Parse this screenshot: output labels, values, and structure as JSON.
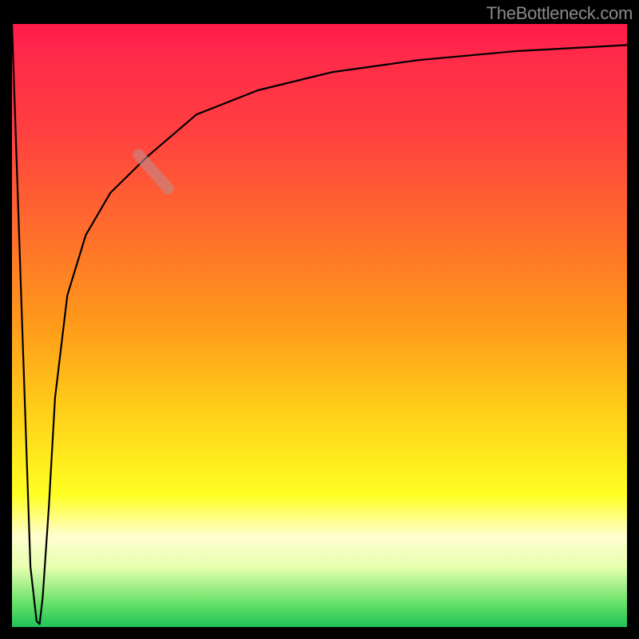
{
  "watermark": "TheBottleneck.com",
  "chart_data": {
    "type": "line",
    "title": "",
    "xlabel": "",
    "ylabel": "",
    "xlim": [
      0,
      100
    ],
    "ylim": [
      0,
      100
    ],
    "grid": false,
    "legend": false,
    "notes": "No axis ticks or numeric labels are visible; values are estimated from pixel positions relative to plot extents (0–100 on both axes).",
    "series": [
      {
        "name": "curve",
        "x": [
          0,
          1.5,
          3,
          4,
          4.5,
          5,
          6,
          7,
          9,
          12,
          16,
          22,
          30,
          40,
          52,
          66,
          82,
          100
        ],
        "y": [
          100,
          55,
          10,
          1,
          0.5,
          5,
          20,
          38,
          55,
          65,
          72,
          78,
          85,
          89,
          92,
          94,
          95.5,
          96.5
        ],
        "color": "#000000"
      }
    ],
    "highlight_segment": {
      "x_range": [
        20,
        26
      ],
      "y_range": [
        72,
        79
      ],
      "color": "#c08a8a",
      "opacity": 0.6,
      "description": "Short pale/rosy diagonal band overlaid on the curve"
    },
    "background_gradient": {
      "direction": "vertical",
      "stops": [
        {
          "pos": 0.0,
          "color": "#ff1a4a"
        },
        {
          "pos": 0.35,
          "color": "#ff6f2b"
        },
        {
          "pos": 0.65,
          "color": "#ffd21a"
        },
        {
          "pos": 0.85,
          "color": "#fffed0"
        },
        {
          "pos": 0.96,
          "color": "#68e268"
        },
        {
          "pos": 1.0,
          "color": "#1fc25a"
        }
      ]
    }
  }
}
